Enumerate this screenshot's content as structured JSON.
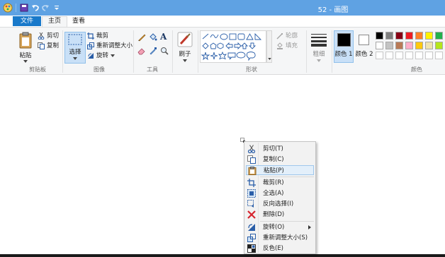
{
  "window": {
    "title": "52 - 画图",
    "app_icon": "paint-app-icon",
    "quick_access": [
      "save-icon",
      "undo-icon",
      "redo-icon",
      "customize-icon"
    ]
  },
  "tabs": [
    {
      "label": "文件",
      "active": false
    },
    {
      "label": "主页",
      "active": true
    },
    {
      "label": "查看",
      "active": false
    }
  ],
  "ribbon": {
    "clipboard": {
      "group_label": "剪贴板",
      "paste_label": "粘贴",
      "cut_label": "剪切",
      "copy_label": "复制"
    },
    "image": {
      "group_label": "图像",
      "select_label": "选择",
      "crop_label": "裁剪",
      "resize_label": "重新调整大小",
      "rotate_label": "旋转"
    },
    "tools": {
      "group_label": "工具",
      "text_tool_glyph": "A"
    },
    "brushes": {
      "label": "刷子"
    },
    "shapes": {
      "group_label": "形状",
      "outline_label": "轮廓",
      "fill_label": "填充"
    },
    "size": {
      "label": "粗细"
    },
    "colors": {
      "group_label": "颜色",
      "color1_label": "颜色 1",
      "color2_label": "颜色 2",
      "color1_value": "#000000",
      "color2_value": "#ffffff",
      "palette_row1": [
        "#000000",
        "#7f7f7f",
        "#880015",
        "#ed1c24",
        "#ff7f27",
        "#fff200",
        "#22b14c",
        "#00a2e8"
      ],
      "palette_row2": [
        "#ffffff",
        "#c3c3c3",
        "#b97a57",
        "#ffaec9",
        "#ffc90e",
        "#efe4b0",
        "#b5e61d",
        "#99d9ea"
      ]
    }
  },
  "context_menu": {
    "items": [
      {
        "label": "剪切(T)",
        "icon": "scissors-icon",
        "highlighted": false
      },
      {
        "label": "复制(C)",
        "icon": "copy-icon",
        "highlighted": false
      },
      {
        "label": "粘贴(P)",
        "icon": "paste-icon",
        "highlighted": true
      },
      {
        "label": "裁剪(R)",
        "icon": "crop-icon",
        "highlighted": false
      },
      {
        "label": "全选(A)",
        "icon": "select-all-icon",
        "highlighted": false
      },
      {
        "label": "反向选择(I)",
        "icon": "invert-selection-icon",
        "highlighted": false
      },
      {
        "label": "删除(D)",
        "icon": "delete-icon",
        "highlighted": false
      },
      {
        "label": "旋转(O)",
        "icon": "rotate-icon",
        "highlighted": false,
        "submenu": true
      },
      {
        "label": "重新调整大小(S)",
        "icon": "resize-icon",
        "highlighted": false
      },
      {
        "label": "反色(E)",
        "icon": "invert-color-icon",
        "highlighted": false
      }
    ]
  }
}
